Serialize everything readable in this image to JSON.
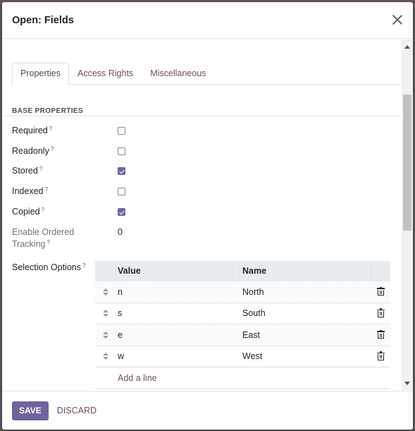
{
  "modal": {
    "title": "Open: Fields"
  },
  "tabs": [
    {
      "label": "Properties",
      "active": true
    },
    {
      "label": "Access Rights",
      "active": false
    },
    {
      "label": "Miscellaneous",
      "active": false
    }
  ],
  "section_title": "BASE PROPERTIES",
  "help_marker": "?",
  "fields": [
    {
      "label": "Required",
      "checked": false
    },
    {
      "label": "Readonly",
      "checked": false
    },
    {
      "label": "Stored",
      "checked": true
    },
    {
      "label": "Indexed",
      "checked": false
    },
    {
      "label": "Copied",
      "checked": true
    }
  ],
  "tracking": {
    "label_line1": "Enable Ordered",
    "label_line2": "Tracking",
    "value": "0"
  },
  "selection": {
    "label": "Selection Options",
    "columns": {
      "value": "Value",
      "name": "Name"
    },
    "rows": [
      {
        "value": "n",
        "name": "North"
      },
      {
        "value": "s",
        "name": "South"
      },
      {
        "value": "e",
        "name": "East"
      },
      {
        "value": "w",
        "name": "West"
      }
    ],
    "add_line": "Add a line"
  },
  "footer": {
    "save": "SAVE",
    "discard": "DISCARD"
  },
  "colors": {
    "accent": "#71639e",
    "link": "#714B67"
  }
}
